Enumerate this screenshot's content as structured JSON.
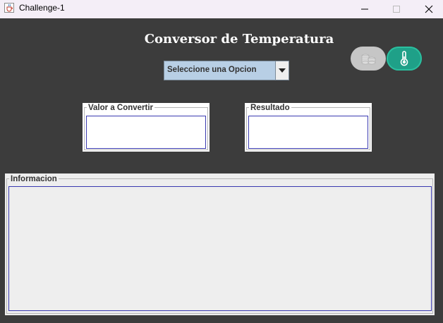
{
  "window": {
    "title": "Challenge-1",
    "icons": {
      "app": "java-cup-icon",
      "minimize": "minimize-icon",
      "maximize": "maximize-icon",
      "close": "close-icon"
    }
  },
  "main": {
    "heading": "Conversor de Temperatura",
    "combo": {
      "selected": "Seleccione una Opcion"
    },
    "mode_buttons": [
      {
        "icon": "coins-icon",
        "state": "inactive"
      },
      {
        "icon": "thermometer-icon",
        "state": "active"
      }
    ],
    "input_panel": {
      "legend": "Valor a Convertir",
      "value": ""
    },
    "result_panel": {
      "legend": "Resultado",
      "value": ""
    },
    "info_panel": {
      "legend": "Informacion",
      "value": ""
    }
  },
  "colors": {
    "background": "#3c3c3c",
    "accent_active": "#1fa088",
    "inactive_button": "#c6c6c6",
    "combo_fill": "#b8cfe5",
    "field_border": "#3a3ab0"
  }
}
